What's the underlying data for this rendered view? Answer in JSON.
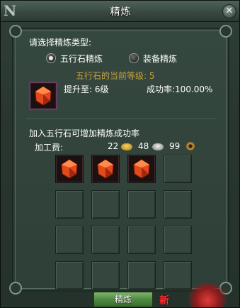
{
  "window": {
    "title": "精炼",
    "close_symbol": "✕",
    "corner_glyph": "N"
  },
  "refine": {
    "prompt": "请选择精炼类型:",
    "options": [
      {
        "label": "五行石精炼",
        "selected": true
      },
      {
        "label": "装备精炼",
        "selected": false
      }
    ],
    "current_level_text": "五行石的当前等级: 5",
    "upgrade_text": "提升至: 6级",
    "success_text": "成功率:100.00%",
    "hint_text": "加入五行石可增加精炼成功率",
    "fee": {
      "label": "加工费:",
      "gold": "22",
      "silver": "48",
      "copper": "99"
    },
    "grid": {
      "rows": 4,
      "cols": 4,
      "filled_count": 3
    },
    "button_label": "精炼",
    "new_badge": "新"
  },
  "colors": {
    "panel": "#2e3f37",
    "gold_text": "#c9a23c",
    "gem": "#e24a1e",
    "button": "#4f8a43"
  },
  "icons": {
    "main_slot": "wuxing-stone-icon",
    "grid_gem": "wuxing-stone-icon",
    "gold": "gold-coin-icon",
    "silver": "silver-coin-icon",
    "copper": "copper-coin-icon"
  }
}
